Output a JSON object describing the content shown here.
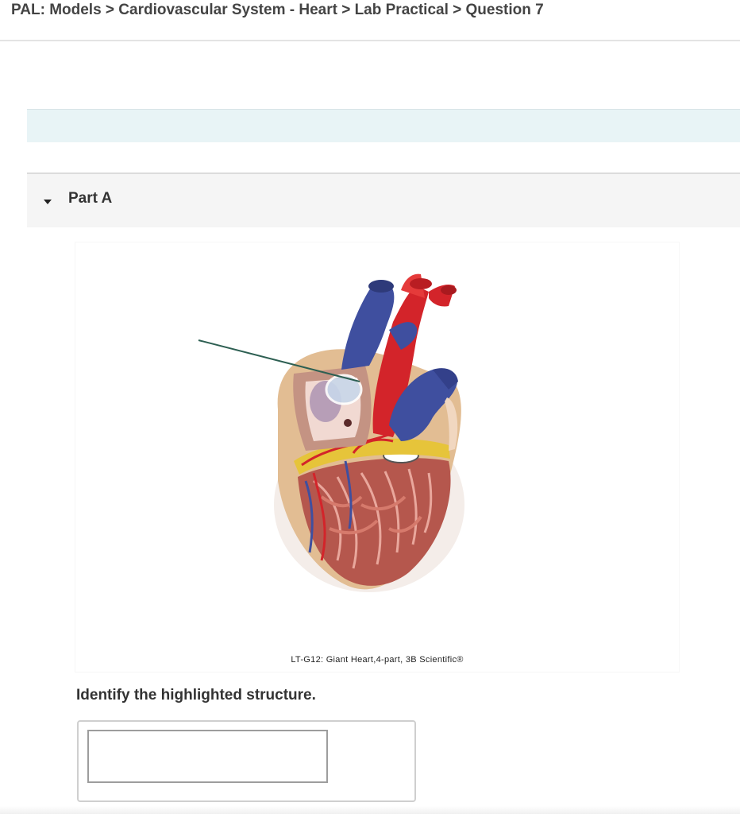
{
  "breadcrumb": {
    "text": "PAL: Models > Cardiovascular System - Heart > Lab Practical > Question 7"
  },
  "part": {
    "label": "Part A",
    "toggle_icon": "caret-down-icon"
  },
  "figure": {
    "caption": "LT-G12: Giant Heart,4-part, 3B Scientific®",
    "image_subject": "heart-model-image",
    "pointer": "leader-line"
  },
  "question": {
    "prompt": "Identify the highlighted structure.",
    "answer_value": "",
    "answer_placeholder": ""
  },
  "colors": {
    "banner": "#e8f4f6",
    "part_bar": "#f5f5f5",
    "artery_red": "#d3242a",
    "vein_blue": "#3f4f9f",
    "fat_yellow": "#e6c43a",
    "muscle": "#b55a4e"
  }
}
